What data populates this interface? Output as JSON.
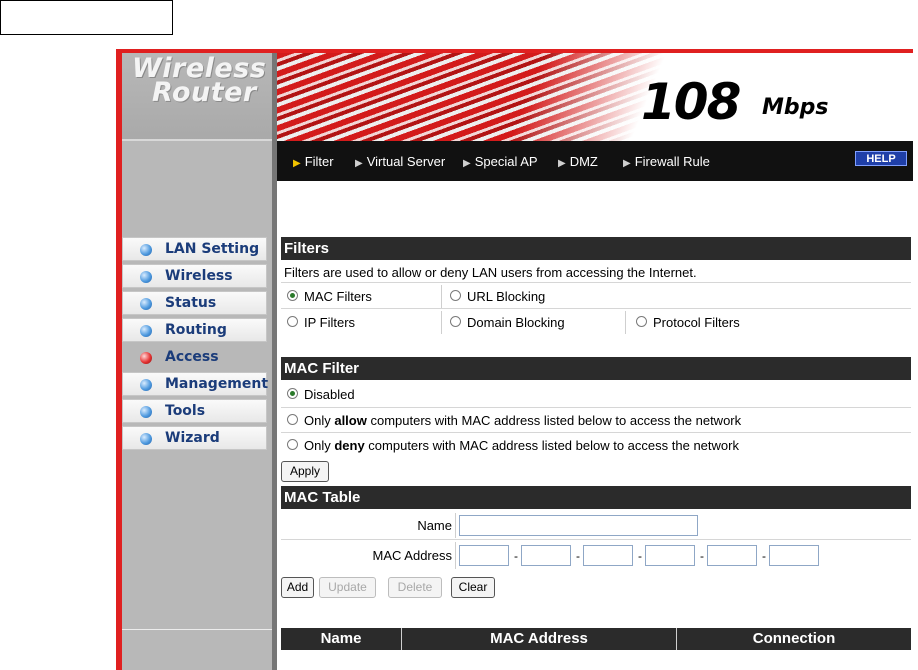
{
  "brand": {
    "line1": "Wireless",
    "line2": "Router"
  },
  "banner": {
    "speed": "108",
    "unit": "Mbps"
  },
  "nav": {
    "items": [
      {
        "label": "Filter",
        "selected": true
      },
      {
        "label": "Virtual Server",
        "selected": false
      },
      {
        "label": "Special AP",
        "selected": false
      },
      {
        "label": "DMZ",
        "selected": false
      },
      {
        "label": "Firewall Rule",
        "selected": false
      }
    ],
    "help": "HELP"
  },
  "menu": {
    "items": [
      {
        "label": "LAN Setting",
        "active": false
      },
      {
        "label": "Wireless",
        "active": false
      },
      {
        "label": "Status",
        "active": false
      },
      {
        "label": "Routing",
        "active": false
      },
      {
        "label": "Access",
        "active": true
      },
      {
        "label": "Management",
        "active": false
      },
      {
        "label": "Tools",
        "active": false
      },
      {
        "label": "Wizard",
        "active": false
      }
    ]
  },
  "filters": {
    "title": "Filters",
    "description": "Filters are used to allow or deny LAN users from accessing the Internet.",
    "options": {
      "mac": "MAC Filters",
      "url": "URL Blocking",
      "ip": "IP Filters",
      "domain": "Domain Blocking",
      "protocol": "Protocol Filters"
    },
    "selected": "MAC Filters"
  },
  "mac_filter": {
    "title": "MAC Filter",
    "disabled": "Disabled",
    "allow": {
      "pre": "Only ",
      "bold": "allow",
      "post": " computers with MAC address listed below to access the network"
    },
    "deny": {
      "pre": "Only ",
      "bold": "deny",
      "post": " computers with MAC address listed below to access the network"
    },
    "selected": "Disabled",
    "apply": "Apply"
  },
  "mac_table": {
    "title": "MAC Table",
    "name_label": "Name",
    "mac_label": "MAC Address",
    "name_value": "",
    "separator": "-",
    "buttons": {
      "add": "Add",
      "update": "Update",
      "delete": "Delete",
      "clear": "Clear"
    },
    "columns": [
      "Name",
      "MAC Address",
      "Connection"
    ]
  },
  "colors": {
    "frame": "#e02020",
    "header_bar": "#2b2b2b",
    "nav_bg": "#111111",
    "help_bg": "#1f3fa8"
  }
}
